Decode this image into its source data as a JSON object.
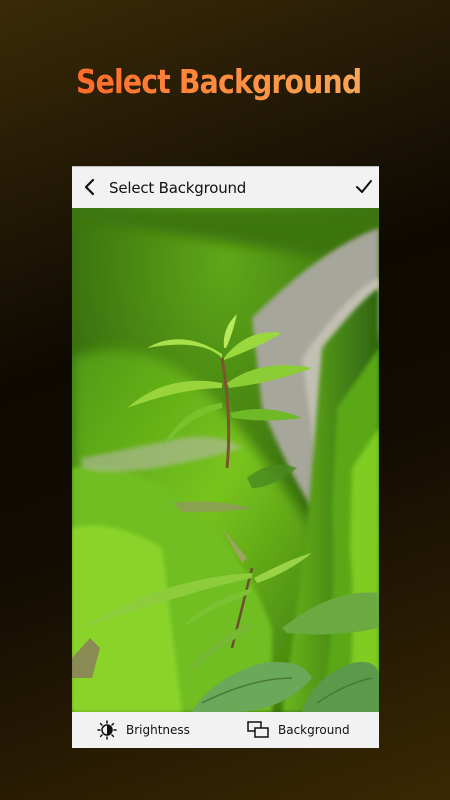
{
  "promo": {
    "title": "Select Background"
  },
  "appbar": {
    "title": "Select Background",
    "back_icon": "chevron-left-icon",
    "confirm_icon": "checkmark-icon"
  },
  "photo": {
    "subject": "green seedling on mossy rock",
    "colors": {
      "moss": "#6fc21a",
      "shadow": "#2d5a0a",
      "leaf": "#a6e25a",
      "rock": "#a9a99a"
    }
  },
  "toolbar": {
    "items": [
      {
        "label": "Brightness",
        "icon": "brightness-icon"
      },
      {
        "label": "Background",
        "icon": "background-icon"
      }
    ]
  },
  "colors": {
    "accent_start": "#ff6a2a",
    "accent_end": "#f7a657",
    "bar_bg": "#f2f2f2"
  }
}
